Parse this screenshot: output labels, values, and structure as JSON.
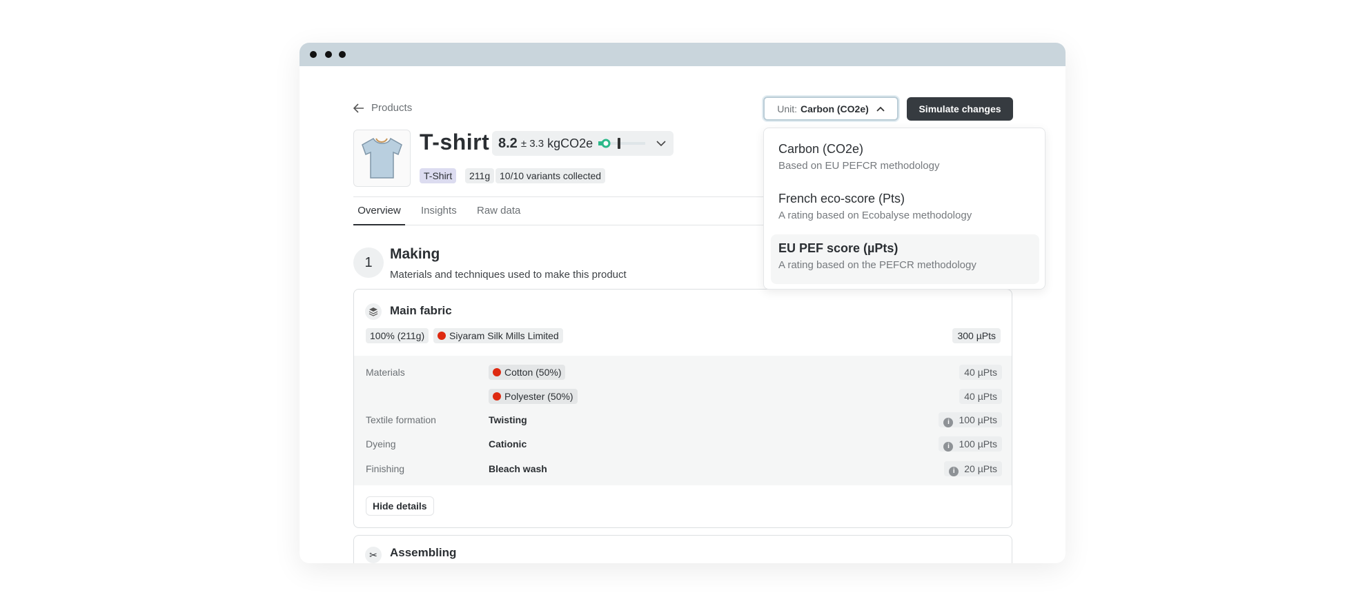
{
  "window": {
    "dots": 3
  },
  "nav": {
    "back_label": "Products"
  },
  "toolbar": {
    "unit_prefix": "Unit:",
    "unit_value": "Carbon (CO2e)",
    "simulate_label": "Simulate changes"
  },
  "unit_dropdown": {
    "options": [
      {
        "title": "Carbon (CO2e)",
        "subtitle": "Based on EU PEFCR methodology"
      },
      {
        "title": "French eco-score (Pts)",
        "subtitle": "A rating based on Ecobalyse methodology"
      },
      {
        "title": "EU PEF score (µPts)",
        "subtitle": "A rating based on the PEFCR methodology",
        "highlighted": true
      }
    ]
  },
  "product": {
    "title": "T-shirt",
    "score": "8.2",
    "uncertainty": "± 3.3",
    "unit": "kgCO2e",
    "tags": [
      "T-Shirt",
      "211g",
      "10/10 variants collected"
    ],
    "accent": "#2bb889"
  },
  "tabs": [
    {
      "label": "Overview",
      "active": true
    },
    {
      "label": "Insights"
    },
    {
      "label": "Raw data"
    }
  ],
  "section": {
    "number": "1",
    "title": "Making",
    "subtitle": "Materials and techniques used to make this product"
  },
  "main_fabric": {
    "title": "Main fabric",
    "share": "100% (211g)",
    "supplier": "Siyaram Silk Mills Limited",
    "total": "300 µPts",
    "rows": [
      {
        "label": "Materials",
        "value": "Cotton (50%)",
        "pts": "40 µPts"
      },
      {
        "label": "",
        "value": "Polyester (50%)",
        "pts": "40 µPts"
      },
      {
        "label": "Textile formation",
        "value": "Twisting",
        "pts": "100 µPts"
      },
      {
        "label": "Dyeing",
        "value": "Cationic",
        "pts": "100 µPts"
      },
      {
        "label": "Finishing",
        "value": "Bleach wash",
        "pts": "20 µPts"
      }
    ],
    "hide_label": "Hide details"
  },
  "assembling": {
    "title": "Assembling"
  }
}
